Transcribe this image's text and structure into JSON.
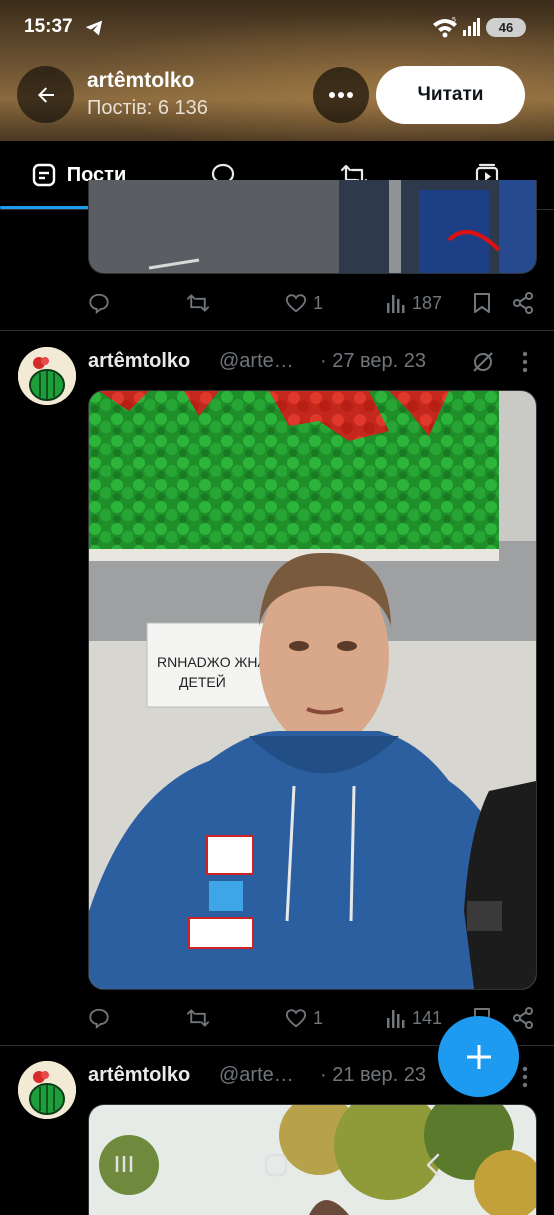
{
  "status_bar": {
    "time": "15:37",
    "battery": "46"
  },
  "profile_header": {
    "name": "artêmtolko",
    "post_count": "Постів: 6 136",
    "follow_label": "Читати"
  },
  "tabs": [
    {
      "label": "Пости",
      "icon": "posts-icon",
      "active": true
    },
    {
      "label": "",
      "icon": "replies-bubble-icon"
    },
    {
      "label": "",
      "icon": "reposts-icon"
    },
    {
      "label": "",
      "icon": "media-icon"
    }
  ],
  "posts": [
    {
      "likes": "1",
      "views": "187"
    },
    {
      "author": "artêmtolko",
      "handle": "@arte…",
      "date": "· 27 вер. 23",
      "image_text": "RNHADЖO ЖHA\nДETEЙ",
      "likes": "1",
      "views": "141"
    },
    {
      "author": "artêmtolko",
      "handle": "@arte…",
      "date": "· 21 вер. 23"
    }
  ],
  "colors": {
    "accent": "#1d9bf0",
    "background": "#000000",
    "muted": "#71767b"
  }
}
